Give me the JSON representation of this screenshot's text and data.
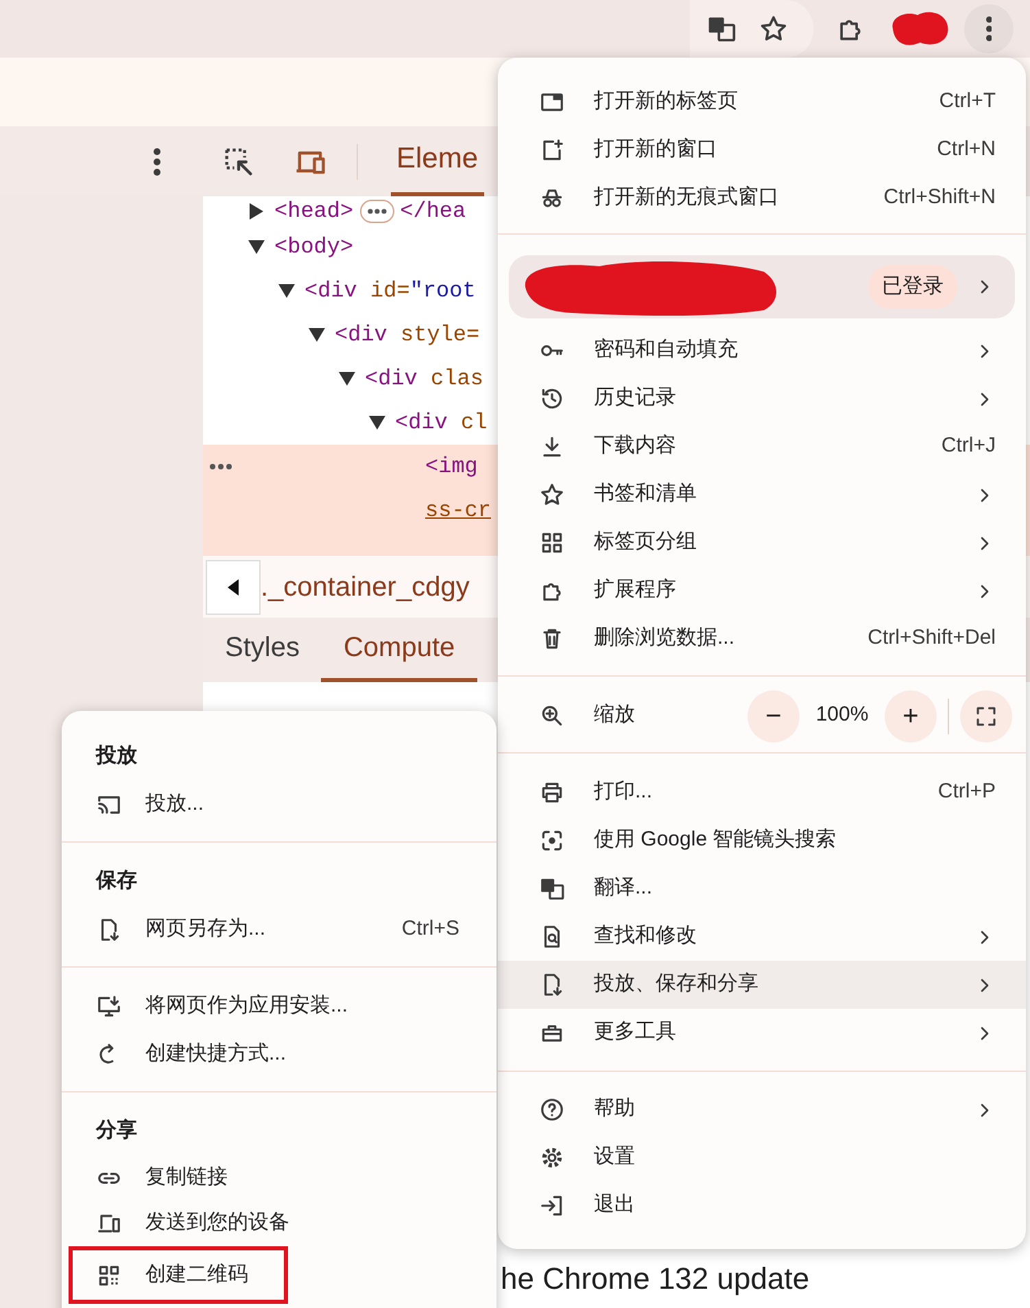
{
  "top_bar": {
    "menu_button": {
      "pressed": true
    }
  },
  "devtools": {
    "panel_tab": {
      "label": "Eleme",
      "selected": true
    },
    "dom_tree": [
      {
        "open": "<head>",
        "expanded": false,
        "selected": false,
        "close": "</hea"
      },
      {
        "open": "<body>",
        "expanded": true,
        "selected": false,
        "children": [
          {
            "open": "<div",
            "attr_name": "id=",
            "attr_value": "\"root",
            "expanded": true,
            "selected": false,
            "children": [
              {
                "open": "<div",
                "attr_name": "style=",
                "expanded": true,
                "selected": false,
                "children": [
                  {
                    "open": "<div",
                    "attr_name": "clas",
                    "expanded": true,
                    "selected": false,
                    "children": [
                      {
                        "open": "<div",
                        "attr_name": "cl",
                        "expanded": true,
                        "selected": false,
                        "children": [
                          {
                            "open": "<img",
                            "selected": true,
                            "continuation": "ss-cr"
                          }
                        ]
                      }
                    ]
                  }
                ]
              }
            ]
          }
        ]
      }
    ],
    "breadcrumb": "._container_cdgy",
    "sidebar_tabs": [
      {
        "label": "Styles",
        "selected": false
      },
      {
        "label": "Compute",
        "selected": true
      }
    ]
  },
  "page_text": "he Chrome 132 update",
  "main_menu": {
    "sections": [
      {
        "items": [
          {
            "kind": "item",
            "label": "打开新的标签页",
            "shortcut": "Ctrl+T",
            "has_submenu": false,
            "highlighted": false
          },
          {
            "kind": "item",
            "label": "打开新的窗口",
            "shortcut": "Ctrl+N",
            "has_submenu": false,
            "highlighted": false
          },
          {
            "kind": "item",
            "label": "打开新的无痕式窗口",
            "shortcut": "Ctrl+Shift+N",
            "has_submenu": false,
            "highlighted": false
          }
        ]
      },
      {
        "items": [
          {
            "kind": "profile",
            "status": "已登录",
            "has_submenu": true,
            "highlighted": false
          },
          {
            "kind": "item",
            "label": "密码和自动填充",
            "has_submenu": true,
            "highlighted": false
          },
          {
            "kind": "item",
            "label": "历史记录",
            "has_submenu": true,
            "highlighted": false
          },
          {
            "kind": "item",
            "label": "下载内容",
            "shortcut": "Ctrl+J",
            "has_submenu": false,
            "highlighted": false
          },
          {
            "kind": "item",
            "label": "书签和清单",
            "has_submenu": true,
            "highlighted": false
          },
          {
            "kind": "item",
            "label": "标签页分组",
            "has_submenu": true,
            "highlighted": false
          },
          {
            "kind": "item",
            "label": "扩展程序",
            "has_submenu": true,
            "highlighted": false
          },
          {
            "kind": "item",
            "label": "删除浏览数据...",
            "shortcut": "Ctrl+Shift+Del",
            "has_submenu": false,
            "highlighted": false
          }
        ]
      },
      {
        "items": [
          {
            "kind": "zoom",
            "label": "缩放",
            "decrease": "−",
            "value": "100%",
            "increase": "+"
          }
        ]
      },
      {
        "items": [
          {
            "kind": "item",
            "label": "打印...",
            "shortcut": "Ctrl+P",
            "has_submenu": false,
            "highlighted": false
          },
          {
            "kind": "item",
            "label": "使用 Google 智能镜头搜索",
            "has_submenu": false,
            "highlighted": false
          },
          {
            "kind": "item",
            "label": "翻译...",
            "has_submenu": false,
            "highlighted": false
          },
          {
            "kind": "item",
            "label": "查找和修改",
            "has_submenu": true,
            "highlighted": false
          },
          {
            "kind": "item",
            "label": "投放、保存和分享",
            "has_submenu": true,
            "highlighted": true
          },
          {
            "kind": "item",
            "label": "更多工具",
            "has_submenu": true,
            "highlighted": false
          }
        ]
      },
      {
        "items": [
          {
            "kind": "item",
            "label": "帮助",
            "has_submenu": true,
            "highlighted": false
          },
          {
            "kind": "item",
            "label": "设置",
            "has_submenu": false,
            "highlighted": false
          },
          {
            "kind": "item",
            "label": "退出",
            "has_submenu": false,
            "highlighted": false
          }
        ]
      }
    ]
  },
  "submenu": {
    "sections": [
      {
        "heading": "投放",
        "items": [
          {
            "label": "投放...",
            "annotated": false
          }
        ]
      },
      {
        "heading": "保存",
        "items": [
          {
            "label": "网页另存为...",
            "shortcut": "Ctrl+S",
            "annotated": false
          }
        ]
      },
      {
        "items": [
          {
            "label": "将网页作为应用安装...",
            "annotated": false
          },
          {
            "label": "创建快捷方式...",
            "annotated": false
          }
        ]
      },
      {
        "heading": "分享",
        "items": [
          {
            "label": "复制链接",
            "annotated": false
          },
          {
            "label": "发送到您的设备",
            "annotated": false
          },
          {
            "label": "创建二维码",
            "annotated": true
          }
        ]
      }
    ]
  }
}
